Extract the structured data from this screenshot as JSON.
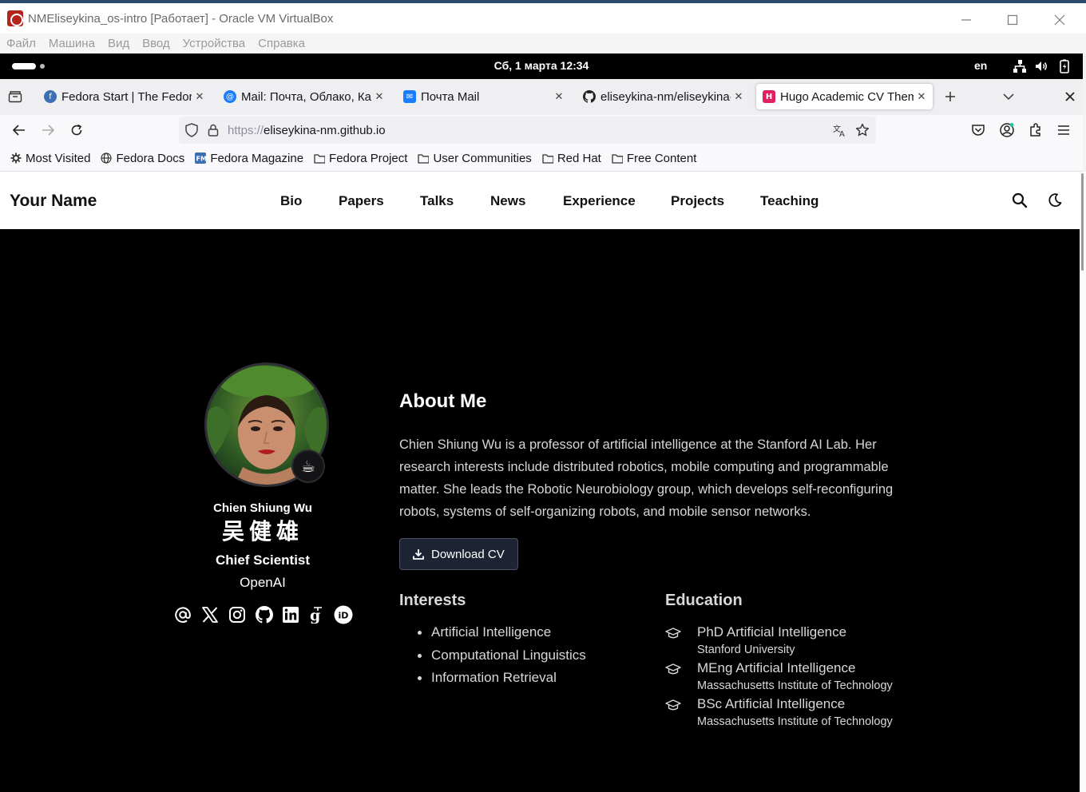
{
  "vbox": {
    "title": "NMEliseykina_os-intro [Работает] - Oracle VM VirtualBox",
    "menu": [
      "Файл",
      "Машина",
      "Вид",
      "Ввод",
      "Устройства",
      "Справка"
    ]
  },
  "gnome": {
    "clock": "Сб, 1 марта  12:34",
    "lang": "en"
  },
  "browser": {
    "tabs": [
      {
        "label": "Fedora Start | The Fedora",
        "icon": "fedora-icon",
        "active": false
      },
      {
        "label": "Mail: Почта, Облако, Кал",
        "icon": "mail-at-icon",
        "active": false
      },
      {
        "label": "Почта Mail",
        "icon": "mail-envelope-icon",
        "active": false
      },
      {
        "label": "eliseykina-nm/eliseykina-",
        "icon": "github-icon",
        "active": false
      },
      {
        "label": "Hugo Academic CV Theme",
        "icon": "hugo-icon",
        "active": true
      }
    ],
    "url_scheme": "https://",
    "url_host": "eliseykina-nm.github.io",
    "bookmarks": [
      {
        "label": "Most Visited",
        "icon": "gear-icon"
      },
      {
        "label": "Fedora Docs",
        "icon": "globe-icon"
      },
      {
        "label": "Fedora Magazine",
        "icon": "fedora-magazine-icon"
      },
      {
        "label": "Fedora Project",
        "icon": "folder-icon"
      },
      {
        "label": "User Communities",
        "icon": "folder-icon"
      },
      {
        "label": "Red Hat",
        "icon": "folder-icon"
      },
      {
        "label": "Free Content",
        "icon": "folder-icon"
      }
    ]
  },
  "site": {
    "brand": "Your Name",
    "nav": [
      "Bio",
      "Papers",
      "Talks",
      "News",
      "Experience",
      "Projects",
      "Teaching"
    ],
    "profile": {
      "name": "Chien Shiung Wu",
      "name_cn": "吴健雄",
      "role": "Chief Scientist",
      "org": "OpenAI",
      "social": [
        "email-icon",
        "x-icon",
        "instagram-icon",
        "github-icon",
        "linkedin-icon",
        "google-scholar-icon",
        "orcid-icon"
      ]
    },
    "about": {
      "title": "About Me",
      "text": "Chien Shiung Wu is a professor of artificial intelligence at the Stanford AI Lab. Her research interests include distributed robotics, mobile computing and programmable matter. She leads the Robotic Neurobiology group, which develops self-reconfiguring robots, systems of self-organizing robots, and mobile sensor networks.",
      "cv_label": "Download CV"
    },
    "interests": {
      "title": "Interests",
      "items": [
        "Artificial Intelligence",
        "Computational Linguistics",
        "Information Retrieval"
      ]
    },
    "education": {
      "title": "Education",
      "items": [
        {
          "course": "PhD Artificial Intelligence",
          "institution": "Stanford University"
        },
        {
          "course": "MEng Artificial Intelligence",
          "institution": "Massachusetts Institute of Technology"
        },
        {
          "course": "BSc Artificial Intelligence",
          "institution": "Massachusetts Institute of Technology"
        }
      ]
    }
  },
  "colors": {
    "page_bg": "#000000",
    "header_bg": "#ffffff",
    "button_bg": "#1e2433",
    "hugo_pink": "#e31f64"
  }
}
